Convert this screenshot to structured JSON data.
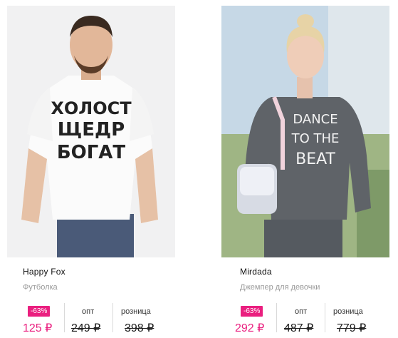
{
  "products": [
    {
      "brand": "Happy Fox",
      "description": "Футболка",
      "discount": "-63%",
      "price_current": "125 ₽",
      "labels": {
        "opt": "опт",
        "retail": "розница"
      },
      "price_opt": "249 ₽",
      "price_retail": "398 ₽",
      "shirt_text": [
        "ХОЛОСТ",
        "ЩЕДР",
        "БОГАТ"
      ]
    },
    {
      "brand": "Mirdada",
      "description": "Джемпер для девочки",
      "discount": "-63%",
      "price_current": "292 ₽",
      "labels": {
        "opt": "опт",
        "retail": "розница"
      },
      "price_opt": "487 ₽",
      "price_retail": "779 ₽",
      "shirt_text": [
        "DANCE",
        "TO THE",
        "BEAT"
      ]
    }
  ],
  "colors": {
    "accent": "#ea1f7f",
    "muted": "#9a9a9a"
  }
}
